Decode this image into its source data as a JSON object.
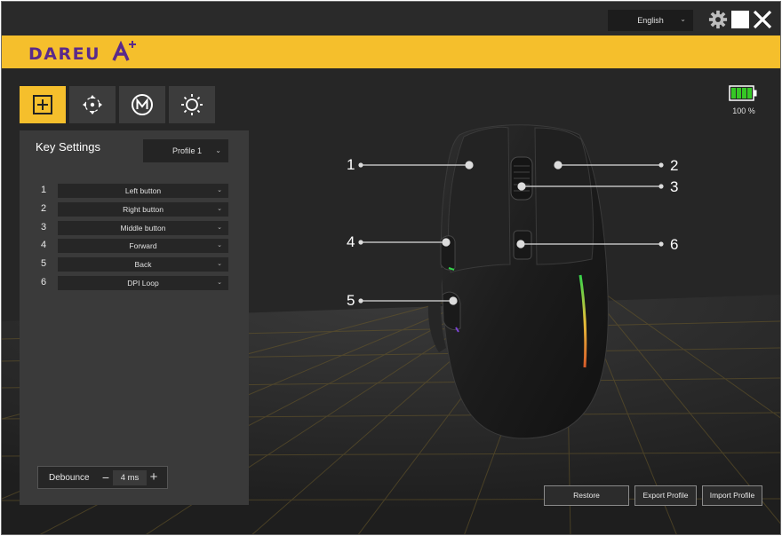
{
  "topbar": {
    "language": "English",
    "icons": {
      "settings": "gear-icon",
      "minimize": "minimize-icon",
      "close": "close-icon"
    }
  },
  "brand": {
    "logo_text": "DAREU",
    "accent": "#f5bf2c"
  },
  "tabs": [
    {
      "name": "key-settings",
      "icon": "plus-square-icon",
      "active": true
    },
    {
      "name": "dpi",
      "icon": "crosshair-icon",
      "active": false
    },
    {
      "name": "macro",
      "icon": "macro-m-icon",
      "active": false
    },
    {
      "name": "lighting",
      "icon": "sun-icon",
      "active": false
    }
  ],
  "battery": {
    "label": "100 %",
    "level": 1.0,
    "color": "#35c825"
  },
  "panel": {
    "title": "Key Settings",
    "profile": "Profile 1",
    "keys": [
      {
        "num": "1",
        "value": "Left button"
      },
      {
        "num": "2",
        "value": "Right button"
      },
      {
        "num": "3",
        "value": "Middle button"
      },
      {
        "num": "4",
        "value": "Forward"
      },
      {
        "num": "5",
        "value": "Back"
      },
      {
        "num": "6",
        "value": "DPI Loop"
      }
    ],
    "debounce": {
      "label": "Debounce",
      "value": "4 ms",
      "minus": "−",
      "plus": "+"
    }
  },
  "mouse": {
    "callouts": [
      "1",
      "2",
      "3",
      "4",
      "5",
      "6"
    ]
  },
  "footer": {
    "restore": "Restore",
    "export": "Export Profile",
    "import": "Import Profile"
  }
}
